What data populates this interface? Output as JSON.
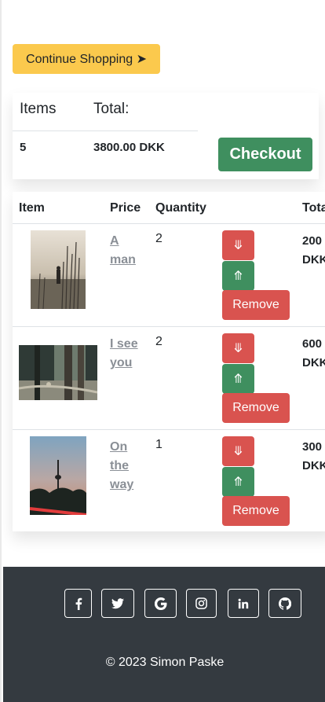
{
  "toolbar": {
    "continue_label": "Continue Shopping ➤"
  },
  "summary": {
    "items_header": "Items",
    "total_header": "Total:",
    "items_value": "5",
    "total_value": "3800.00 DKK",
    "checkout_label": "Checkout"
  },
  "cart": {
    "headers": {
      "item": "Item",
      "price": "Price",
      "quantity": "Quantity",
      "total": "Total"
    },
    "rows": [
      {
        "name": "A man",
        "quantity": "2",
        "total_line1": "200",
        "total_line2": "DKK",
        "down": "⤋",
        "up": "⤊",
        "remove": "Remove"
      },
      {
        "name": "I see you",
        "quantity": "2",
        "total_line1": "600",
        "total_line2": "DKK",
        "down": "⤋",
        "up": "⤊",
        "remove": "Remove"
      },
      {
        "name": "On the way",
        "quantity": "1",
        "total_line1": "300",
        "total_line2": "DKK",
        "down": "⤋",
        "up": "⤊",
        "remove": "Remove"
      }
    ]
  },
  "footer": {
    "social": [
      "facebook-icon",
      "twitter-icon",
      "google-icon",
      "instagram-icon",
      "linkedin-icon",
      "github-icon"
    ],
    "copyright": "© 2023 Simon Paske"
  },
  "colors": {
    "accent_yellow": "#fbc94d",
    "success_green": "#3f8f5f",
    "danger_red": "#d9534f",
    "footer_bg": "#343a40",
    "link_grey": "#8a8f96"
  }
}
